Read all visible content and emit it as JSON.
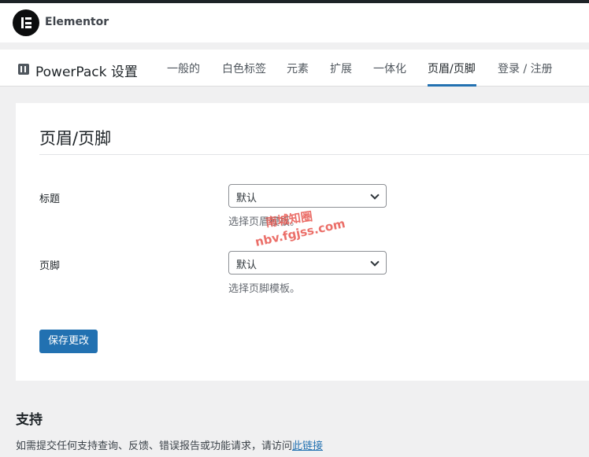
{
  "elementor": {
    "title": "Elementor"
  },
  "powerpack": {
    "title": "PowerPack 设置",
    "tabs": [
      {
        "label": "一般的",
        "active": false
      },
      {
        "label": "白色标签",
        "active": false
      },
      {
        "label": "元素",
        "active": false
      },
      {
        "label": "扩展",
        "active": false
      },
      {
        "label": "一体化",
        "active": false
      },
      {
        "label": "页眉/页脚",
        "active": true
      },
      {
        "label": "登录 / 注册",
        "active": false
      }
    ],
    "accent_color": "#2271b1"
  },
  "section": {
    "title": "页眉/页脚",
    "fields": [
      {
        "label": "标题",
        "value": "默认",
        "description": "选择页眉模板。"
      },
      {
        "label": "页脚",
        "value": "默认",
        "description": "选择页脚模板。"
      }
    ],
    "save_label": "保存更改"
  },
  "support": {
    "title": "支持",
    "text": "如需提交任何支持查询、反馈、错误报告或功能请求，请访问",
    "link_label": "此链接"
  },
  "watermark": {
    "line1": "南城知圈",
    "line2": "nbv.fgjss.com"
  }
}
